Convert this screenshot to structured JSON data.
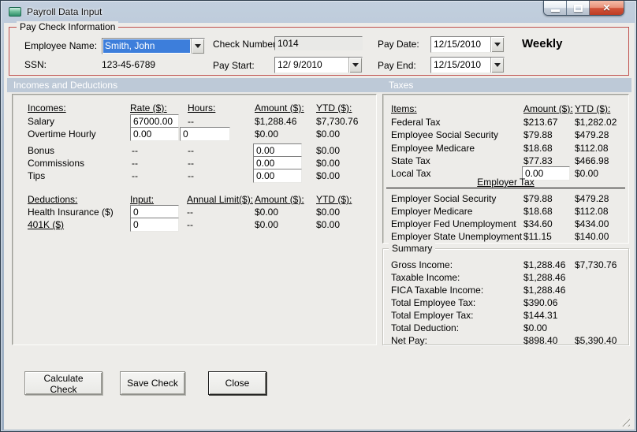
{
  "window": {
    "title": "Payroll Data Input",
    "controls": {
      "minimize": "minimize",
      "maximize": "maximize",
      "close_glyph": "✕"
    }
  },
  "paycheck_info": {
    "group_title": "Pay Check Information",
    "employee_name_label": "Employee Name:",
    "employee_name_value": "Smith, John",
    "ssn_label": "SSN:",
    "ssn_value": "123-45-6789",
    "check_number_label": "Check Number:",
    "check_number_value": "1014",
    "pay_start_label": "Pay Start:",
    "pay_start_value": "12/ 9/2010",
    "pay_date_label": "Pay Date:",
    "pay_date_value": "12/15/2010",
    "pay_end_label": "Pay End:",
    "pay_end_value": "12/15/2010",
    "frequency": "Weekly"
  },
  "sections": {
    "incomes_deductions_title": "Incomes and Deductions",
    "taxes_title": "Taxes"
  },
  "incomes": {
    "headers": {
      "name": "Incomes:",
      "rate": "Rate ($):",
      "hours": "Hours:",
      "amount": "Amount ($):",
      "ytd": "YTD ($):"
    },
    "rows": [
      {
        "label": "Salary",
        "rate_input": "67000.00",
        "hours": "--",
        "amount": "$1,288.46",
        "ytd": "$7,730.76"
      },
      {
        "label": "Overtime Hourly",
        "rate_input": "0.00",
        "hours_input": "0",
        "amount": "$0.00",
        "ytd": "$0.00"
      },
      {
        "label": "Bonus",
        "rate": "--",
        "hours": "--",
        "amount_input": "0.00",
        "ytd": "$0.00"
      },
      {
        "label": "Commissions",
        "rate": "--",
        "hours": "--",
        "amount_input": "0.00",
        "ytd": "$0.00"
      },
      {
        "label": "Tips",
        "rate": "--",
        "hours": "--",
        "amount_input": "0.00",
        "ytd": "$0.00"
      }
    ]
  },
  "deductions": {
    "headers": {
      "name": "Deductions:",
      "input": "Input:",
      "annual_limit": "Annual Limit($):",
      "amount": "Amount ($):",
      "ytd": "YTD ($):"
    },
    "rows": [
      {
        "label": "Health Insurance  ($)",
        "input": "0",
        "annual_limit": "--",
        "amount": "$0.00",
        "ytd": "$0.00"
      },
      {
        "label": "401K  ($)",
        "input": "0",
        "annual_limit": "--",
        "amount": "$0.00",
        "ytd": "$0.00"
      }
    ]
  },
  "taxes": {
    "headers": {
      "items": "Items:",
      "amount": "Amount ($):",
      "ytd": "YTD ($):"
    },
    "employee_rows": [
      {
        "label": "Federal Tax",
        "amount": "$213.67",
        "ytd": "$1,282.02"
      },
      {
        "label": "Employee Social Security",
        "amount": "$79.88",
        "ytd": "$479.28"
      },
      {
        "label": "Employee Medicare",
        "amount": "$18.68",
        "ytd": "$112.08"
      },
      {
        "label": "State Tax",
        "amount": "$77.83",
        "ytd": "$466.98"
      },
      {
        "label": "Local Tax",
        "amount_input": "0.00",
        "ytd": "$0.00"
      }
    ],
    "employer_header": "Employer Tax",
    "employer_rows": [
      {
        "label": "Employer Social Security",
        "amount": "$79.88",
        "ytd": "$479.28"
      },
      {
        "label": "Employer Medicare",
        "amount": "$18.68",
        "ytd": "$112.08"
      },
      {
        "label": "Employer Fed Unemployment",
        "amount": "$34.60",
        "ytd": "$434.00"
      },
      {
        "label": "Employer State Unemployment",
        "amount": "$11.15",
        "ytd": "$140.00"
      }
    ]
  },
  "summary": {
    "group_title": "Summary",
    "rows": [
      {
        "label": "Gross Income:",
        "amount": "$1,288.46",
        "ytd": "$7,730.76"
      },
      {
        "label": "Taxable Income:",
        "amount": "$1,288.46",
        "ytd": ""
      },
      {
        "label": "FICA Taxable Income:",
        "amount": "$1,288.46",
        "ytd": ""
      },
      {
        "label": "Total Employee Tax:",
        "amount": "$390.06",
        "ytd": ""
      },
      {
        "label": "Total Employer Tax:",
        "amount": "$144.31",
        "ytd": ""
      },
      {
        "label": "Total Deduction:",
        "amount": "$0.00",
        "ytd": ""
      },
      {
        "label": "Net Pay:",
        "amount": "$898.40",
        "ytd": "$5,390.40"
      }
    ]
  },
  "buttons": {
    "calculate": "Calculate Check",
    "save": "Save Check",
    "close": "Close"
  },
  "colors": {
    "accent_red": "#C0504D",
    "band_blue_gray": "#BDC9D7",
    "selection_blue": "#3D7EDB",
    "close_button_red": "#C94430",
    "form_background": "#EDECE9"
  }
}
